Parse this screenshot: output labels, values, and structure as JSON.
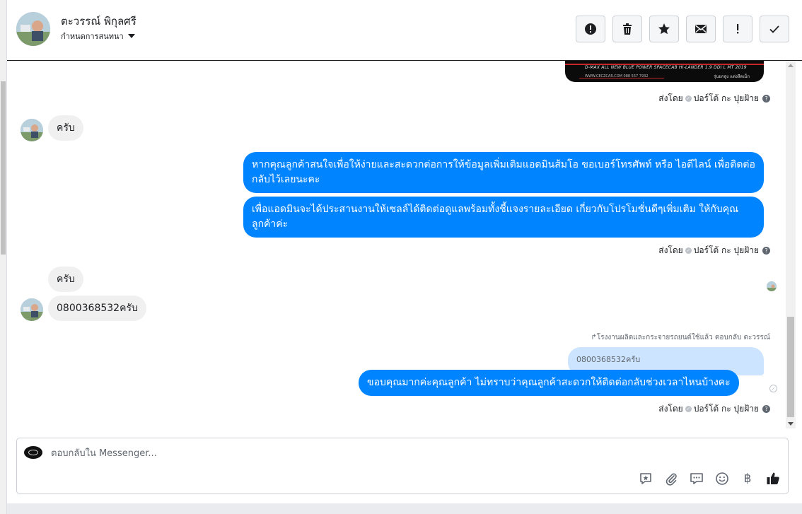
{
  "header": {
    "name": "ตะวรรณ์ พิกุลศรี",
    "sub_label": "กำหนดการสนทนา",
    "toolbar": [
      {
        "name": "spam-button",
        "icon": "alert-circle-icon"
      },
      {
        "name": "delete-button",
        "icon": "trash-icon"
      },
      {
        "name": "star-button",
        "icon": "star-icon"
      },
      {
        "name": "mark-unread-button",
        "icon": "envelope-icon"
      },
      {
        "name": "priority-button",
        "icon": "exclamation-icon"
      },
      {
        "name": "done-button",
        "icon": "check-icon"
      }
    ]
  },
  "image_card": {
    "line1": "D-MAX ALL NEW BLUE POWER SPACECAB HI-LANDER 1.9 DDI L MT 2019",
    "line2": "WWW.CECZCAR.COM  088 557 7932",
    "line3": "รุ่นยกสูง แต่งสีดเม็ก"
  },
  "sent_by": {
    "prefix": "ส่งโดย",
    "agent": "ปอร์โต้ กะ ปุยฝ้าย"
  },
  "messages": {
    "in_1": "ครับ",
    "out_1": "หากคุณลูกค้าสนใจเพื่อให้ง่ายและสะดวกต่อการให้ข้อมูลเพิ่มเติมแอดมินส้มโอ ขอเบอร์โทรศัพท์ หรือ ไอดีไลน์ เพื่อติดต่อกลับไว้เลยนะคะ",
    "out_2": "เพื่อแอดมินจะได้ประสานงานให้เซลล์ได้ติดต่อดูแลพร้อมทั้งชี้แจงรายละเอียด เกี่ยวกับโปรโมชั่นดีๆเพิ่มเติม ให้กับคุณลูกค้าค่ะ",
    "in_2": "ครับ",
    "in_3": "0800368532ครับ",
    "reply_note": "โรงงานผลิตและกระจายรถยนต์ใช้แล้ว ตอบกลับ ตะวรรณ์",
    "quoted": "0800368532ครับ",
    "out_3": "ขอบคุณมากค่ะคุณลูกค้า ไม่ทราบว่าคุณลูกค้าสะดวกให้ติดต่อกลับช่วงเวลาไหนบ้างคะ"
  },
  "composer": {
    "placeholder": "ตอบกลับใน Messenger...",
    "baht_symbol": "฿",
    "tools": [
      "saved-reply-icon",
      "attachment-icon",
      "chat-bubbles-icon",
      "emoji-icon",
      "baht-icon",
      "thumbs-up-icon"
    ]
  },
  "colors": {
    "outgoing": "#0084ff",
    "incoming": "#f1f0f0",
    "quoted": "#cce4ff"
  }
}
